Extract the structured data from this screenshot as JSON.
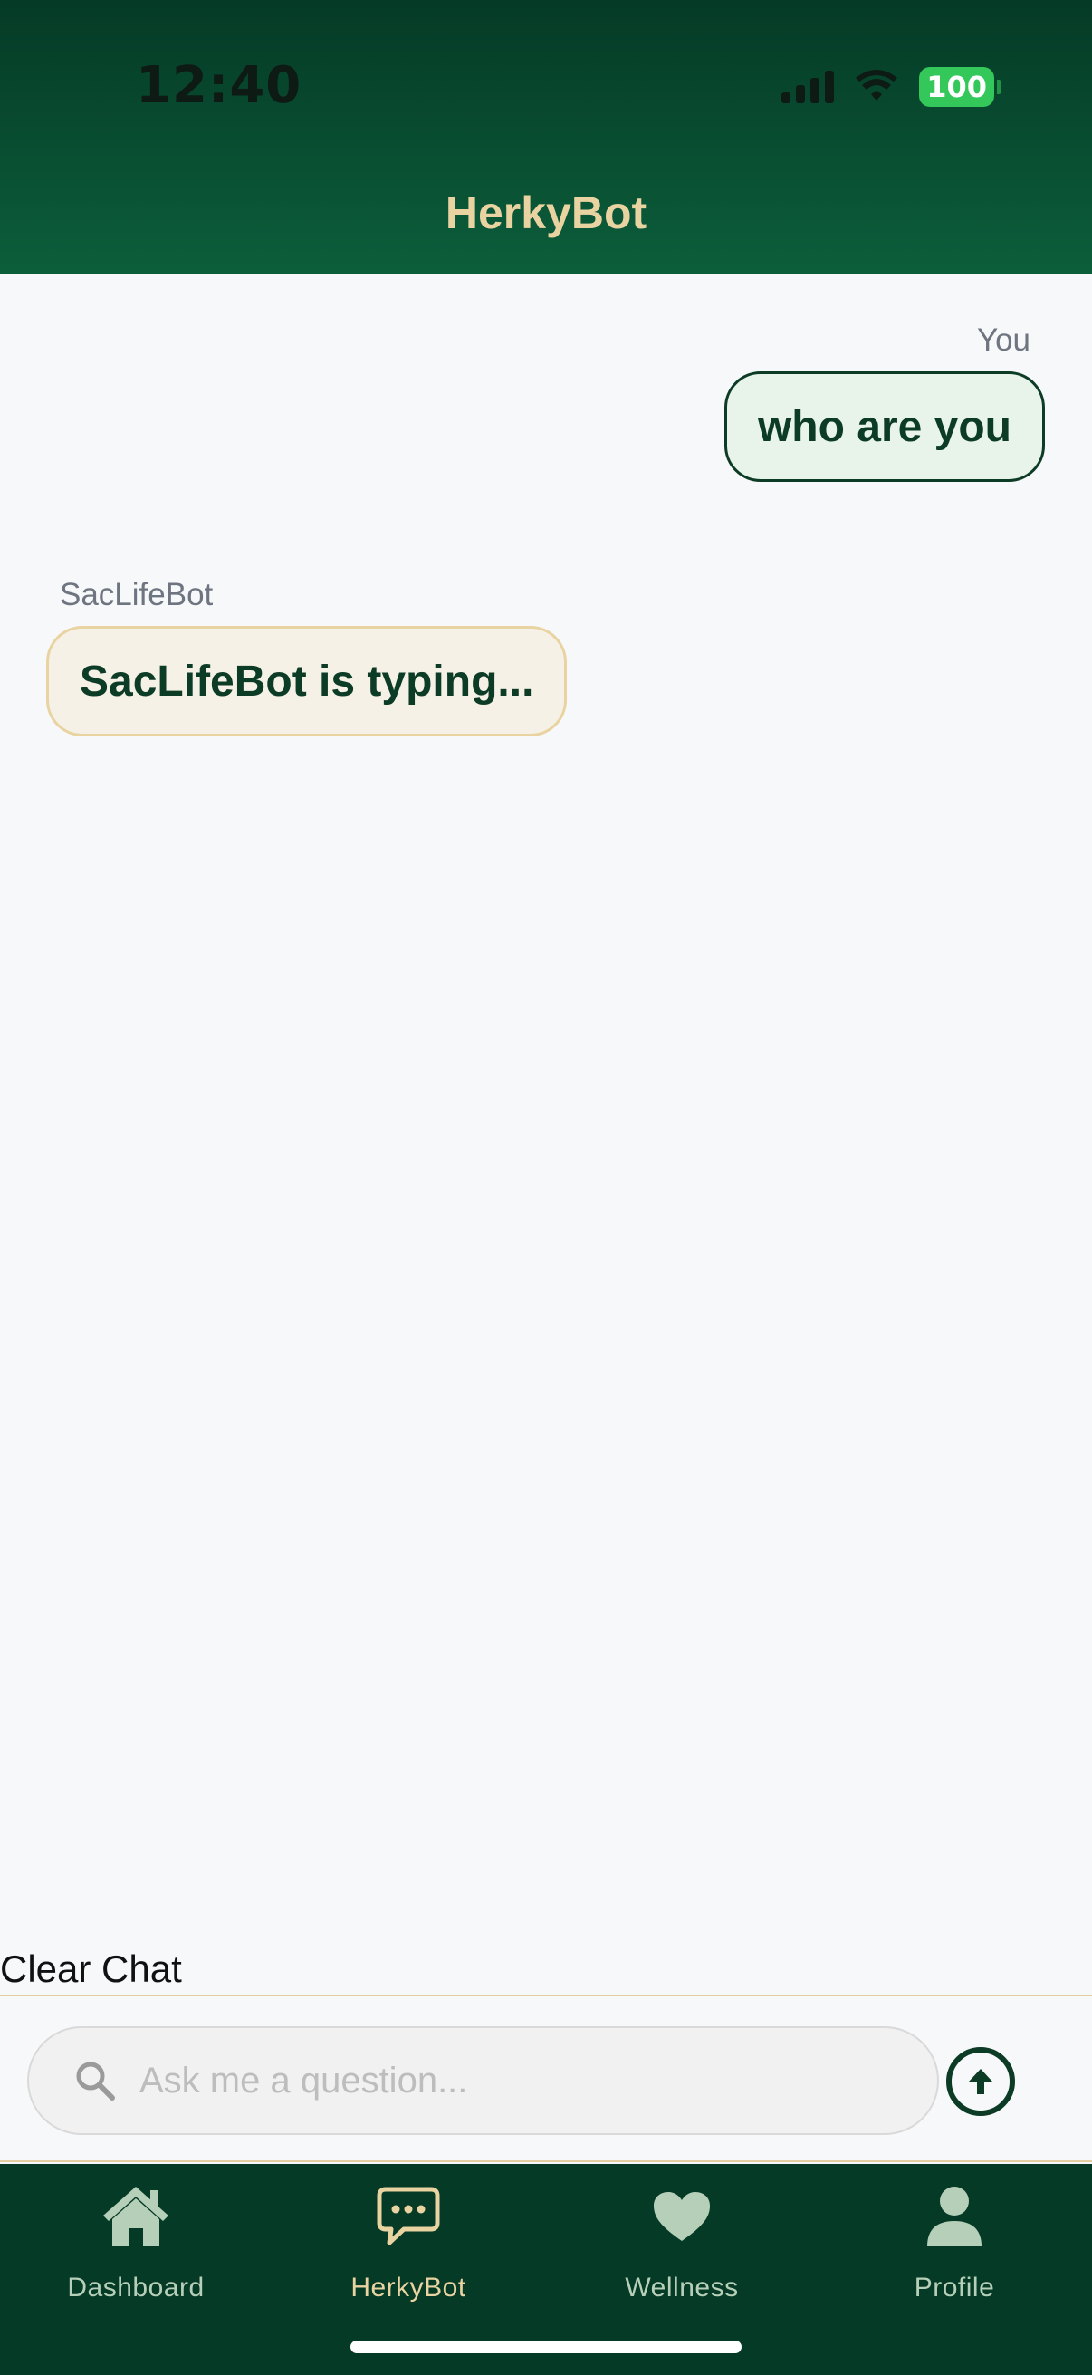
{
  "status_bar": {
    "time": "12:40",
    "battery": "100"
  },
  "header": {
    "title": "HerkyBot"
  },
  "chat": {
    "messages": [
      {
        "sender": "You",
        "text": "who are you"
      },
      {
        "sender": "SacLifeBot",
        "text": "SacLifeBot is typing..."
      }
    ],
    "clear_label": "Clear Chat"
  },
  "input": {
    "placeholder": "Ask me a question...",
    "value": ""
  },
  "tabs": [
    {
      "label": "Dashboard",
      "icon": "home-icon",
      "active": false
    },
    {
      "label": "HerkyBot",
      "icon": "chat-bubble-icon",
      "active": true
    },
    {
      "label": "Wellness",
      "icon": "heart-icon",
      "active": false
    },
    {
      "label": "Profile",
      "icon": "person-icon",
      "active": false
    }
  ],
  "colors": {
    "primary_green": "#0c3b26",
    "header_gradient_top": "#053a26",
    "header_gradient_bottom": "#0c5e3b",
    "gold": "#e8d3a1",
    "user_bubble_bg": "#e8f3ea",
    "bot_bubble_bg": "#f6f1e6",
    "battery_green": "#34c759"
  }
}
